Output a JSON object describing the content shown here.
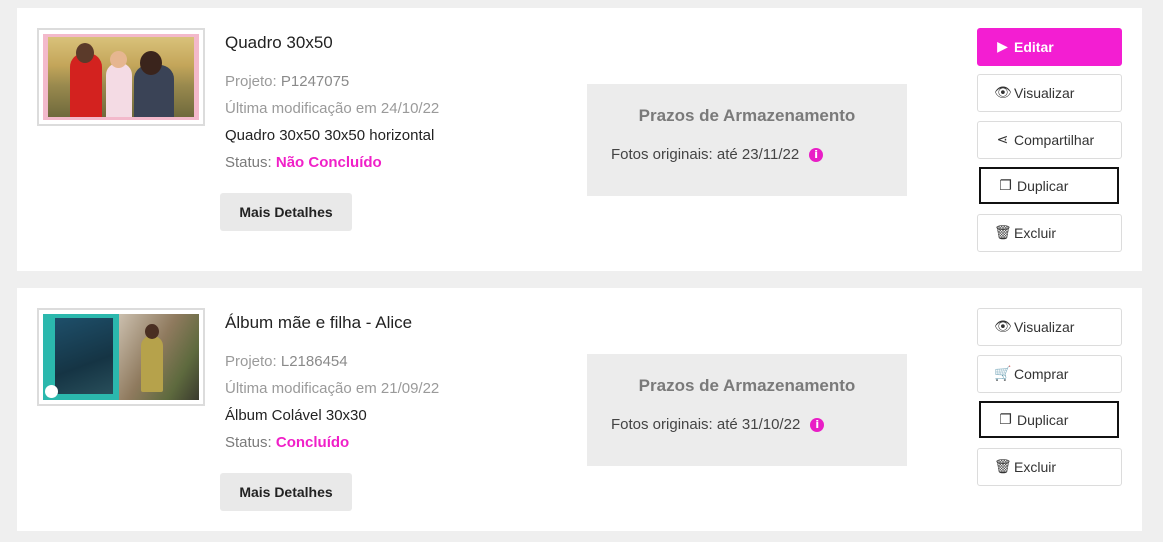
{
  "projects": [
    {
      "title": "Quadro 30x50",
      "project_label": "Projeto:",
      "project_code": "P1247075",
      "modified": "Última modificação em 24/10/22",
      "product": "Quadro 30x50 30x50 horizontal",
      "status_label": "Status:",
      "status_value": "Não Concluído",
      "details_label": "Mais Detalhes",
      "storage_title": "Prazos de Armazenamento",
      "storage_line": "Fotos originais: até 23/11/22",
      "actions": [
        {
          "label": "Editar",
          "icon": "play-circle-icon"
        },
        {
          "label": "Visualizar",
          "icon": "eye-icon"
        },
        {
          "label": "Compartilhar",
          "icon": "share-icon"
        },
        {
          "label": "Duplicar",
          "icon": "copy-icon"
        },
        {
          "label": "Excluir",
          "icon": "trash-icon"
        }
      ]
    },
    {
      "title": "Álbum mãe e filha - Alice",
      "project_label": "Projeto:",
      "project_code": "L2186454",
      "modified": "Última modificação em 21/09/22",
      "product": "Álbum Colável 30x30",
      "status_label": "Status:",
      "status_value": "Concluído",
      "details_label": "Mais Detalhes",
      "storage_title": "Prazos de Armazenamento",
      "storage_line": "Fotos originais: até 31/10/22",
      "actions": [
        {
          "label": "Visualizar",
          "icon": "eye-icon"
        },
        {
          "label": "Comprar",
          "icon": "cart-icon"
        },
        {
          "label": "Duplicar",
          "icon": "copy-icon"
        },
        {
          "label": "Excluir",
          "icon": "trash-icon"
        }
      ]
    }
  ],
  "colors": {
    "accent": "#f31ed2",
    "status": "#f020c8",
    "storage_bg": "#ececec"
  }
}
